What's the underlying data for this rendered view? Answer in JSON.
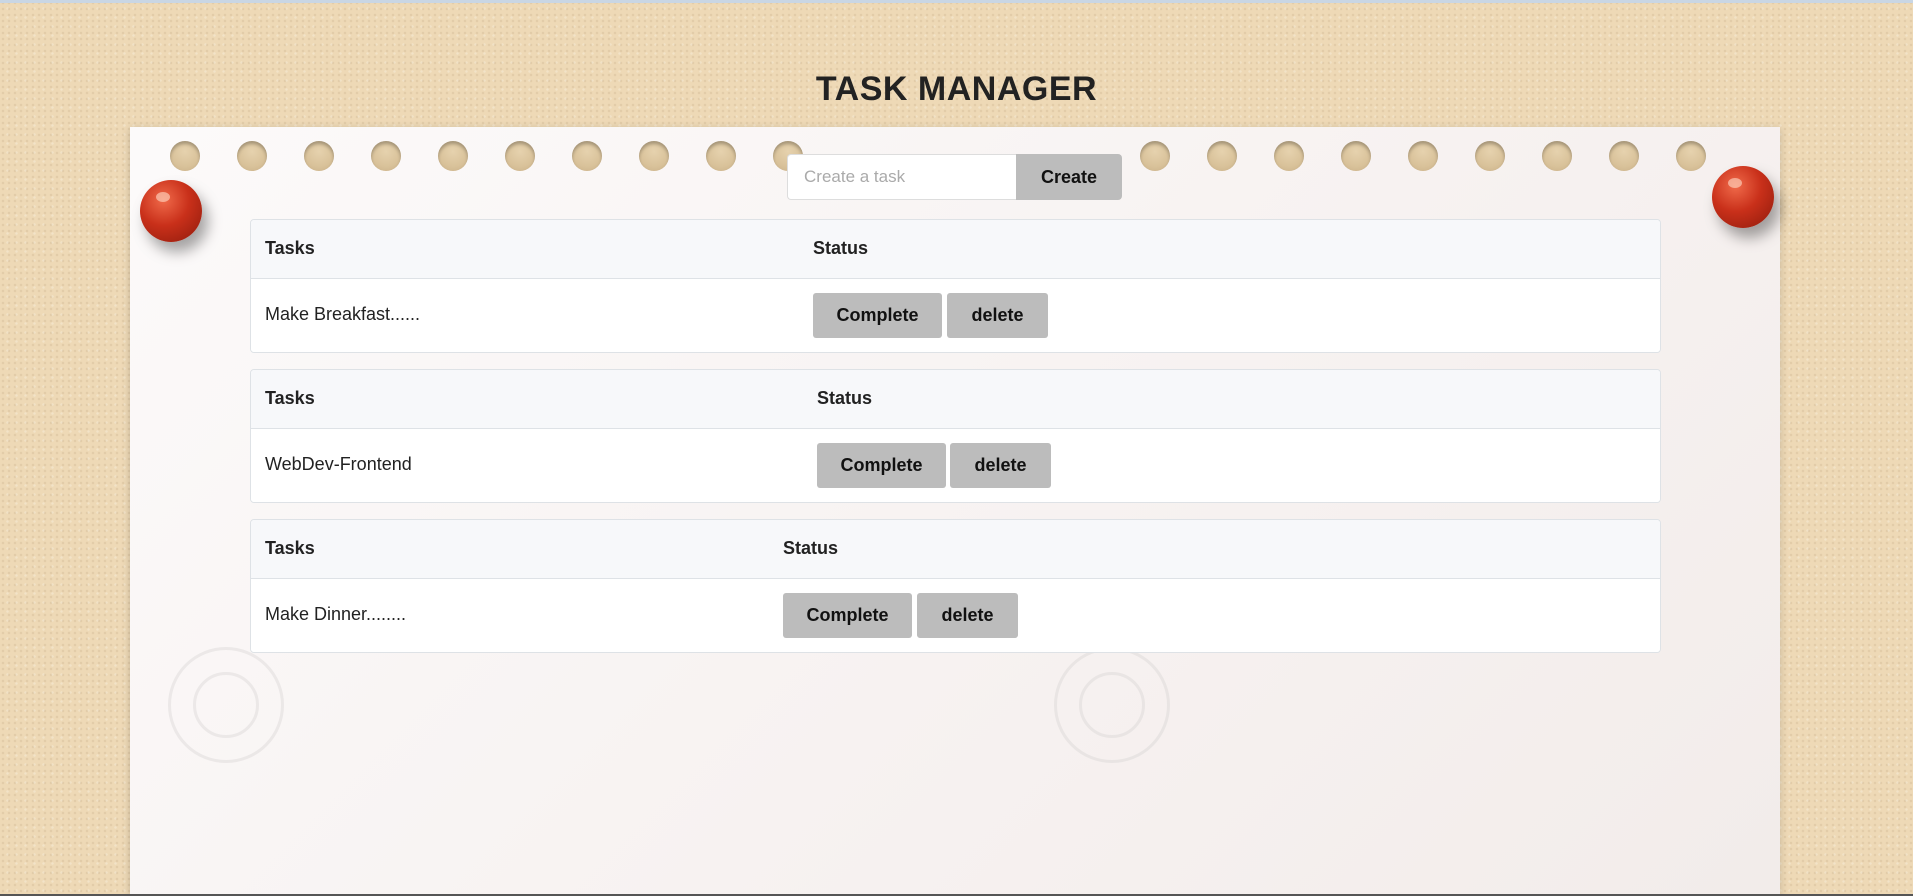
{
  "header": {
    "title": "TASK MANAGER"
  },
  "create": {
    "placeholder": "Create a task",
    "button_label": "Create"
  },
  "tables": [
    {
      "col_task": "Tasks",
      "col_status": "Status",
      "task": "Make Breakfast......",
      "complete_label": "Complete",
      "delete_label": "delete"
    },
    {
      "col_task": "Tasks",
      "col_status": "Status",
      "task": "WebDev-Frontend",
      "complete_label": "Complete",
      "delete_label": "delete"
    },
    {
      "col_task": "Tasks",
      "col_status": "Status",
      "task": "Make Dinner........",
      "complete_label": "Complete",
      "delete_label": "delete"
    }
  ],
  "colors": {
    "button_bg": "#bcbcbc",
    "header_bg": "#f7f8fa",
    "pin": "#c9301a",
    "cork": "#eed9b6"
  }
}
